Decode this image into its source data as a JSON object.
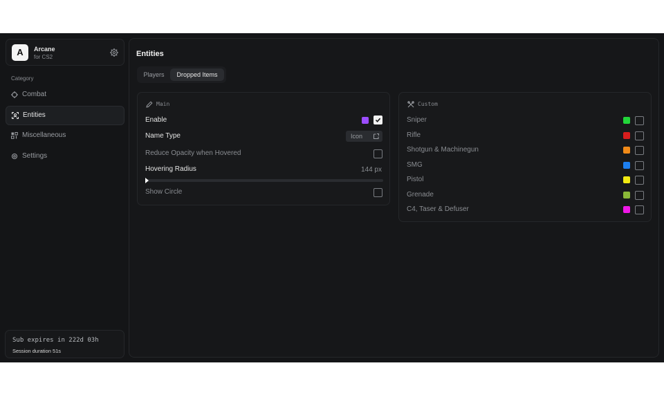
{
  "brand": {
    "logo_letter": "A",
    "name": "Arcane",
    "subtitle": "for CS2",
    "settings_icon": "gear-icon"
  },
  "sidebar": {
    "category_label": "Category",
    "items": [
      {
        "label": "Combat",
        "icon": "crosshair-icon",
        "active": false
      },
      {
        "label": "Entities",
        "icon": "entity-scan-icon",
        "active": true
      },
      {
        "label": "Miscellaneous",
        "icon": "misc-icon",
        "active": false
      },
      {
        "label": "Settings",
        "icon": "gear-icon",
        "active": false
      }
    ]
  },
  "subscription": {
    "expires": "Sub expires in 222d 03h",
    "session": "Session duration 51s"
  },
  "page": {
    "title": "Entities",
    "tabs": [
      {
        "label": "Players",
        "active": false
      },
      {
        "label": "Dropped Items",
        "active": true
      }
    ]
  },
  "main_panel": {
    "title": "Main",
    "enable": {
      "label": "Enable",
      "color": "#9b4dff",
      "checked": true
    },
    "name_type": {
      "label": "Name Type",
      "value": "Icon"
    },
    "reduce_opacity": {
      "label": "Reduce Opacity when Hovered",
      "checked": false
    },
    "hovering_radius": {
      "label": "Hovering Radius",
      "value": "144 px",
      "slider_fraction": 0.0
    },
    "show_circle": {
      "label": "Show Circle",
      "checked": false
    }
  },
  "custom_panel": {
    "title": "Custom",
    "items": [
      {
        "label": "Sniper",
        "color": "#22d63a",
        "checked": false
      },
      {
        "label": "Rifle",
        "color": "#d81d1d",
        "checked": false
      },
      {
        "label": "Shotgun & Machinegun",
        "color": "#f08a18",
        "checked": false
      },
      {
        "label": "SMG",
        "color": "#1d7ff0",
        "checked": false
      },
      {
        "label": "Pistol",
        "color": "#f2ea12",
        "checked": false
      },
      {
        "label": "Grenade",
        "color": "#8ab838",
        "checked": false
      },
      {
        "label": "C4, Taser & Defuser",
        "color": "#f018e8",
        "checked": false
      }
    ]
  }
}
